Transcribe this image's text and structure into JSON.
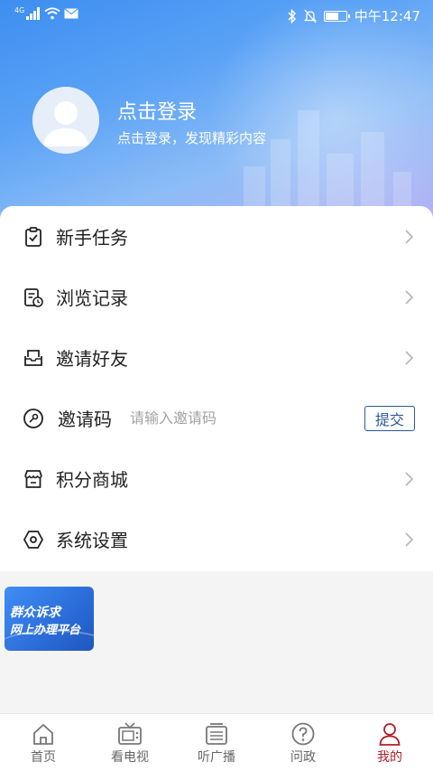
{
  "status_bar": {
    "network": "4G",
    "time": "中午12:47"
  },
  "profile": {
    "title": "点击登录",
    "subtitle": "点击登录，发现精彩内容"
  },
  "menu": [
    {
      "label": "新手任务",
      "icon": "task-check-icon"
    },
    {
      "label": "浏览记录",
      "icon": "history-icon"
    },
    {
      "label": "邀请好友",
      "icon": "envelope-icon"
    },
    {
      "label": "积分商城",
      "icon": "store-icon"
    },
    {
      "label": "系统设置",
      "icon": "settings-icon"
    }
  ],
  "invite_code": {
    "label": "邀请码",
    "placeholder": "请输入邀请码",
    "submit_label": "提交"
  },
  "banner": {
    "line1": "群众诉求",
    "line2": "网上办理平台"
  },
  "tabs": [
    {
      "label": "首页",
      "icon": "home-icon"
    },
    {
      "label": "看电视",
      "icon": "tv-icon"
    },
    {
      "label": "听广播",
      "icon": "radio-icon"
    },
    {
      "label": "问政",
      "icon": "question-icon"
    },
    {
      "label": "我的",
      "icon": "user-icon",
      "active": true
    }
  ],
  "colors": {
    "accent": "#b01e2a",
    "button_border": "#2a5a9a",
    "header_gradient_start": "#3d8ef0",
    "header_gradient_end": "#b7b2f3"
  }
}
